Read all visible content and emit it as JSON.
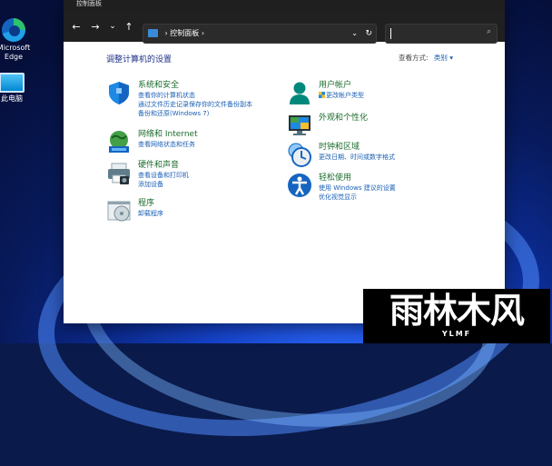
{
  "desktop": {
    "icons": [
      {
        "label": "Microsoft Edge"
      },
      {
        "label": "此电脑"
      }
    ]
  },
  "window": {
    "title": "控制面板",
    "nav": {
      "back": "←",
      "forward": "→",
      "dropdown": "⌄",
      "up": "↑"
    },
    "address": {
      "path": "控制面板",
      "separator": "›",
      "chevron": "⌄",
      "refresh": "↻"
    },
    "search": {
      "placeholder": ""
    }
  },
  "content": {
    "heading": "调整计算机的设置",
    "view_by_label": "查看方式:",
    "view_by_value": "类别 ▾",
    "left_items": [
      {
        "title": "系统和安全",
        "links": [
          "查看你的计算机状态",
          "通过文件历史记录保存你的文件备份副本",
          "备份和还原(Windows 7)"
        ],
        "icon": "shield-icon"
      },
      {
        "title": "网络和 Internet",
        "links": [
          "查看网络状态和任务"
        ],
        "icon": "network-icon"
      },
      {
        "title": "硬件和声音",
        "links": [
          "查看设备和打印机",
          "添加设备"
        ],
        "icon": "printer-icon"
      },
      {
        "title": "程序",
        "links": [
          "卸载程序"
        ],
        "icon": "programs-icon"
      }
    ],
    "right_items": [
      {
        "title": "用户帐户",
        "links": [
          "更改帐户类型"
        ],
        "icon": "user-icon"
      },
      {
        "title": "外观和个性化",
        "links": [],
        "icon": "monitor-icon"
      },
      {
        "title": "时钟和区域",
        "links": [
          "更改日期、时间或数字格式"
        ],
        "icon": "clock-icon"
      },
      {
        "title": "轻松使用",
        "links": [
          "使用 Windows 建议的设置",
          "优化视觉显示"
        ],
        "icon": "accessibility-icon"
      }
    ]
  },
  "watermark": {
    "big": "雨林木风",
    "small": "YLMF"
  },
  "colors": {
    "link": "#1a5fb4",
    "title": "#1b6b2d",
    "heading": "#1e3287"
  }
}
